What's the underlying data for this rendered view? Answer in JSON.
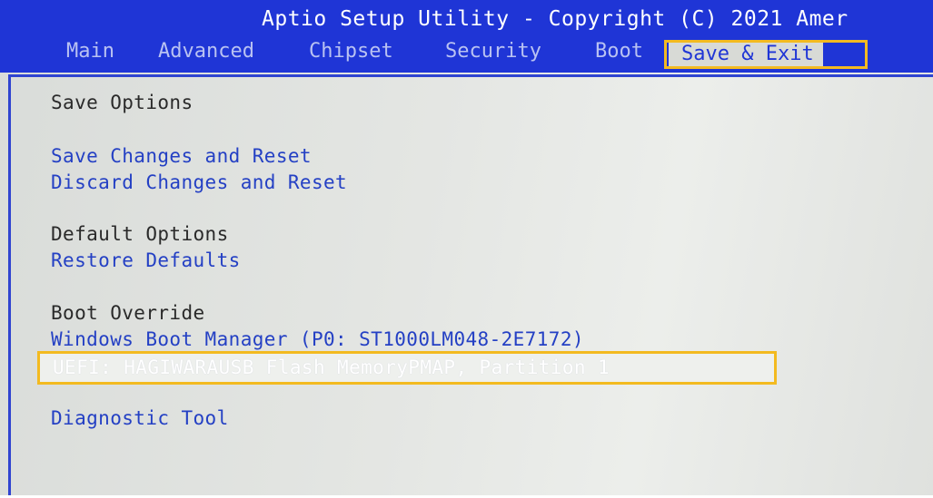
{
  "header": {
    "title": "Aptio Setup Utility - Copyright (C) 2021 Amer"
  },
  "menu": {
    "tabs": [
      {
        "label": "Main"
      },
      {
        "label": "Advanced"
      },
      {
        "label": "Chipset"
      },
      {
        "label": "Security"
      },
      {
        "label": "Boot"
      },
      {
        "label": "Save & Exit"
      }
    ],
    "active_tab": "Save & Exit"
  },
  "save_options": {
    "heading": "Save Options",
    "save_changes_and_reset": "Save Changes and Reset",
    "discard_changes_and_reset": "Discard Changes and Reset"
  },
  "default_options": {
    "heading": "Default Options",
    "restore_defaults": "Restore Defaults"
  },
  "boot_override": {
    "heading": "Boot Override",
    "windows_boot_manager": "Windows Boot Manager (P0: ST1000LM048-2E7172)",
    "uefi_usb": "UEFI: HAGIWARAUSB Flash MemoryPMAP, Partition 1"
  },
  "diagnostic": {
    "tool": "Diagnostic Tool"
  },
  "colors": {
    "header_blue": "#1f35d6",
    "option_blue": "#2440c4",
    "highlight": "#f3ba20",
    "panel_bg": "#e4e6e3"
  }
}
